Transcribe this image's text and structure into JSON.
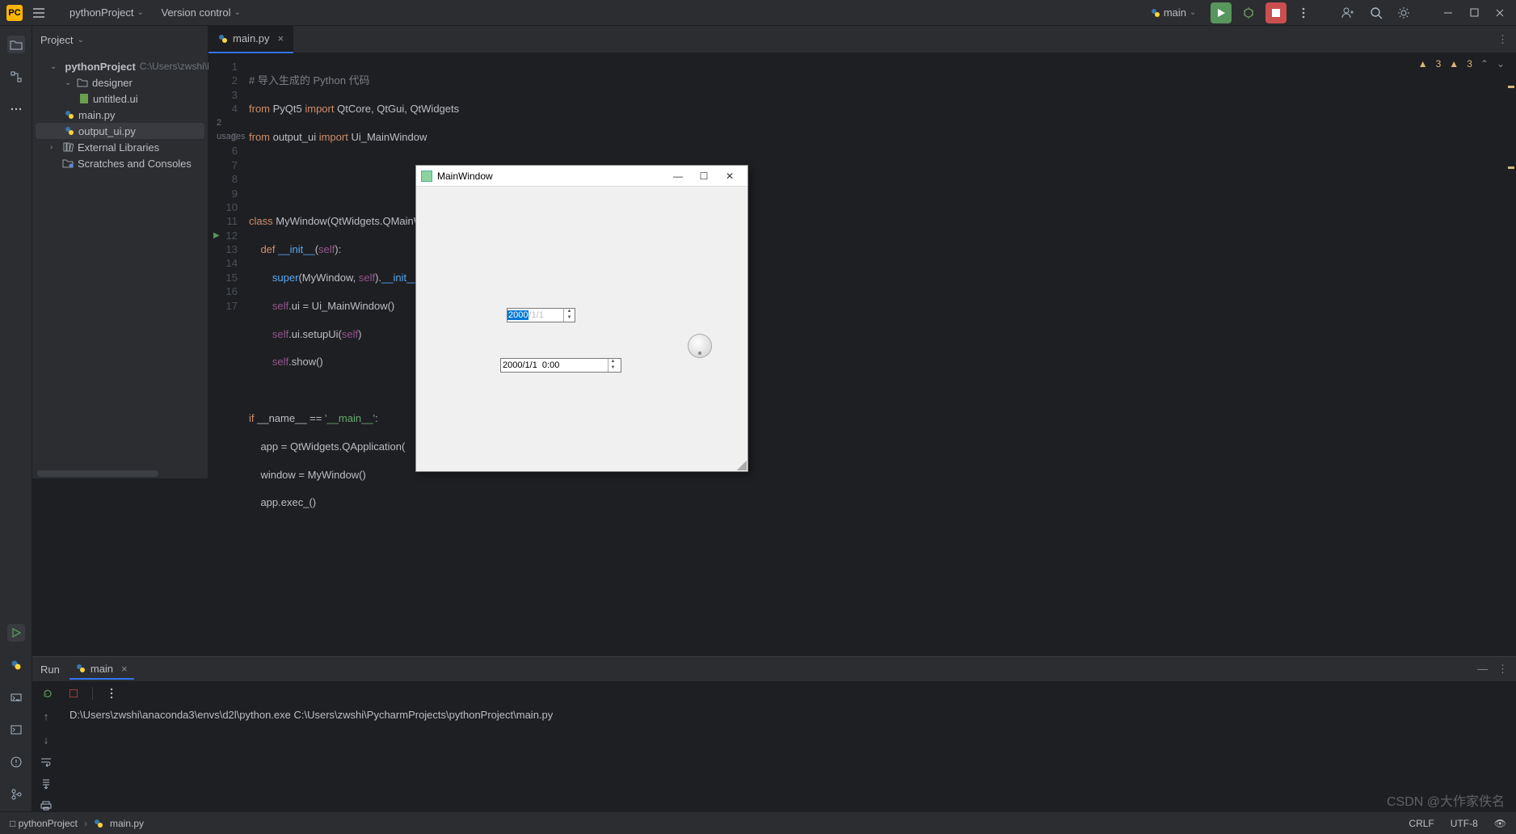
{
  "menubar": {
    "project_name": "pythonProject",
    "vcs_label": "Version control",
    "run_config": "main"
  },
  "project_panel": {
    "header": "Project",
    "root": {
      "name": "pythonProject",
      "path": "C:\\Users\\zwshi\\Pych"
    },
    "items": [
      {
        "name": "designer",
        "type": "folder"
      },
      {
        "name": "untitled.ui",
        "type": "ui"
      },
      {
        "name": "main.py",
        "type": "py"
      },
      {
        "name": "output_ui.py",
        "type": "py",
        "selected": true
      }
    ],
    "external": "External Libraries",
    "scratches": "Scratches and Consoles"
  },
  "editor": {
    "tab_name": "main.py",
    "inspections": {
      "warn_a": "3",
      "warn_b": "3"
    },
    "usages_hint": "2 usages",
    "lines": [
      "# 导入生成的 Python 代码",
      "from PyQt5 import QtCore, QtGui, QtWidgets",
      "from output_ui import Ui_MainWindow",
      "",
      "class MyWindow(QtWidgets.QMainWindow):",
      "    def __init__(self):",
      "        super(MyWindow, self).__init__()",
      "        self.ui = Ui_MainWindow()",
      "        self.ui.setupUi(self)",
      "        self.show()",
      "",
      "if __name__ == '__main__':",
      "    app = QtWidgets.QApplication(",
      "    window = MyWindow()",
      "    app.exec_()",
      "",
      ""
    ]
  },
  "run_panel": {
    "title": "Run",
    "tab": "main",
    "output": "D:\\Users\\zwshi\\anaconda3\\envs\\d2l\\python.exe C:\\Users\\zwshi\\PycharmProjects\\pythonProject\\main.py"
  },
  "status_bar": {
    "crumb1": "pythonProject",
    "crumb2": "main.py",
    "line_ending": "CRLF",
    "encoding": "UTF-8"
  },
  "qt_window": {
    "title": "MainWindow",
    "date_year_sel": "2000",
    "date_rest": "/1/1",
    "datetime_value": "2000/1/1  0:00"
  },
  "watermark": "CSDN @大作家佚名"
}
